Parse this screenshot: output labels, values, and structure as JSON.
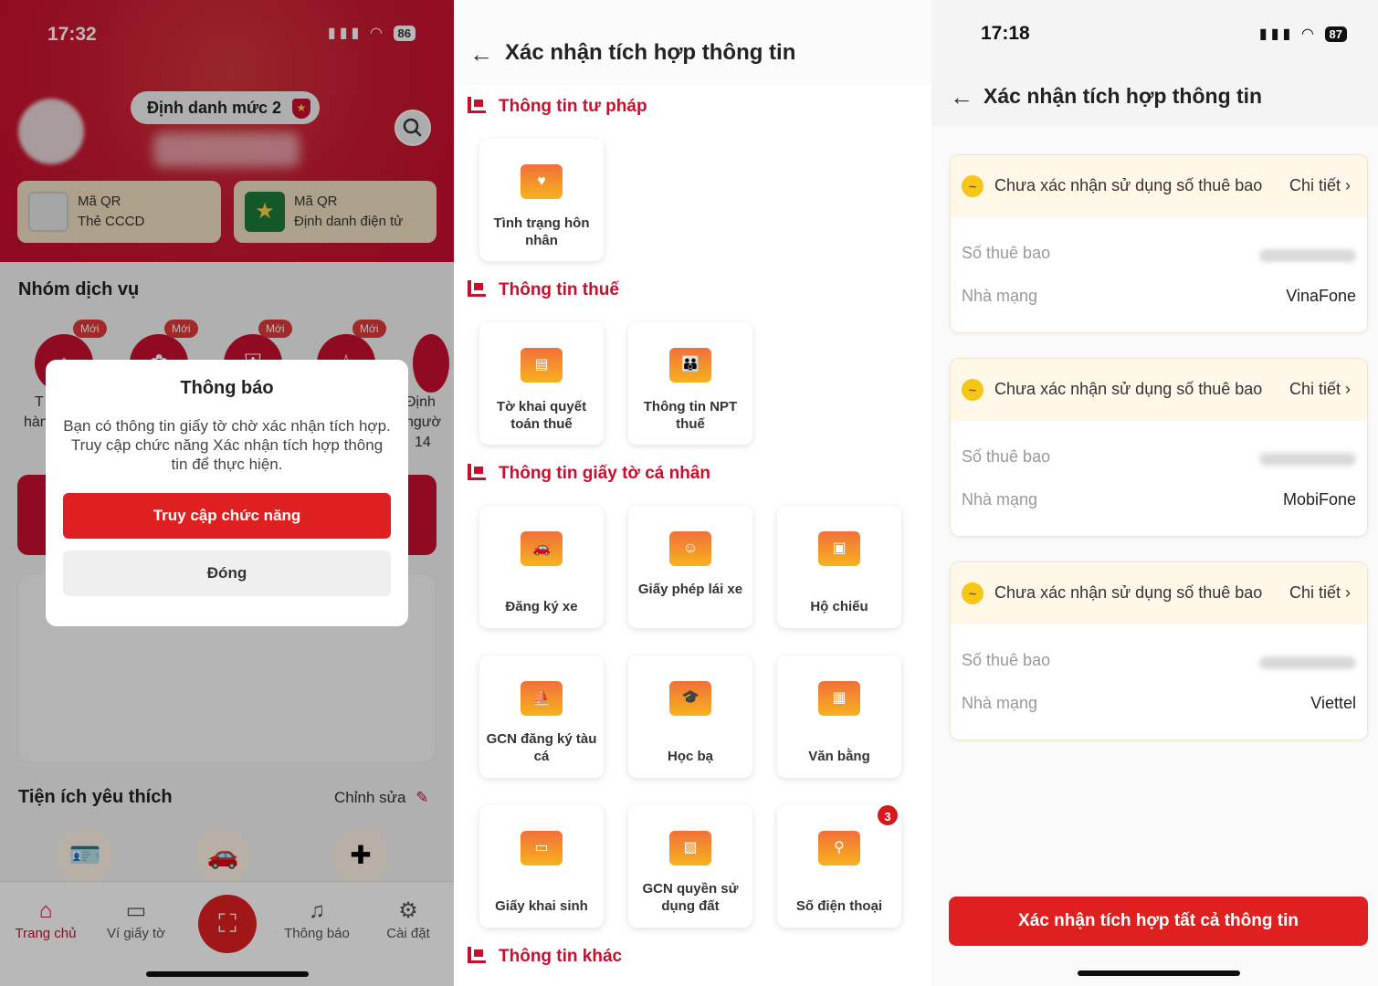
{
  "panel1": {
    "status_time": "17:32",
    "status_battery": "86",
    "level_label": "Định danh mức 2",
    "qr_cards": [
      {
        "line1": "Mã QR",
        "line2": "Thẻ CCCD"
      },
      {
        "line1": "Mã QR",
        "line2": "Định danh điện tử"
      }
    ],
    "services_title": "Nhóm dịch vụ",
    "new_badge": "Mới",
    "service_labels_partial": [
      "T",
      "hàn",
      "Định",
      "ngườ",
      "14"
    ],
    "favorites_title": "Tiện ích yêu thích",
    "favorites_edit": "Chỉnh sửa",
    "tabs": [
      {
        "label": "Trang chủ",
        "icon": "home-icon",
        "active": true
      },
      {
        "label": "Ví giấy tờ",
        "icon": "wallet-icon",
        "active": false
      },
      {
        "label": "Thông báo",
        "icon": "bell-icon",
        "active": false
      },
      {
        "label": "Cài đặt",
        "icon": "settings-icon",
        "active": false
      }
    ],
    "modal": {
      "title": "Thông báo",
      "body": "Bạn có thông tin giấy tờ chờ xác nhận tích hợp. Truy cập chức năng Xác nhận tích hợp thông tin để thực hiện.",
      "primary_label": "Truy cập chức năng",
      "secondary_label": "Đóng"
    }
  },
  "panel2": {
    "title": "Xác nhận tích hợp thông tin",
    "sections": [
      {
        "title": "Thông tin tư pháp",
        "items": [
          "Tình trạng hôn nhân"
        ]
      },
      {
        "title": "Thông tin thuế",
        "items": [
          "Tờ khai quyết toán thuế",
          "Thông tin NPT thuế"
        ]
      },
      {
        "title": "Thông tin giấy tờ cá nhân",
        "items": [
          "Đăng ký xe",
          "Giấy phép lái xe",
          "Hộ chiếu",
          "GCN đăng ký tàu cá",
          "Học bạ",
          "Văn bằng",
          "Giấy khai sinh",
          "GCN quyền sử dụng đất",
          "Số điện thoại"
        ]
      },
      {
        "title": "Thông tin khác",
        "items": []
      }
    ],
    "phone_badge": "3"
  },
  "panel3": {
    "status_time": "17:18",
    "status_battery": "87",
    "title": "Xác nhận tích hợp thông tin",
    "subscriptions": [
      {
        "status": "Chưa xác nhận sử dụng số thuê bao",
        "detail": "Chi tiết",
        "number_label": "Số thuê bao",
        "carrier_label": "Nhà mạng",
        "carrier": "VinaFone"
      },
      {
        "status": "Chưa xác nhận sử dụng số thuê bao",
        "detail": "Chi tiết",
        "number_label": "Số thuê bao",
        "carrier_label": "Nhà mạng",
        "carrier": "MobiFone"
      },
      {
        "status": "Chưa xác nhận sử dụng số thuê bao",
        "detail": "Chi tiết",
        "number_label": "Số thuê bao",
        "carrier_label": "Nhà mạng",
        "carrier": "Viettel"
      }
    ],
    "confirm_all_label": "Xác nhận tích hợp tất cả thông tin"
  },
  "colors": {
    "brand_red": "#c8102e",
    "button_red": "#e02020",
    "warning_yellow": "#f5c518"
  }
}
